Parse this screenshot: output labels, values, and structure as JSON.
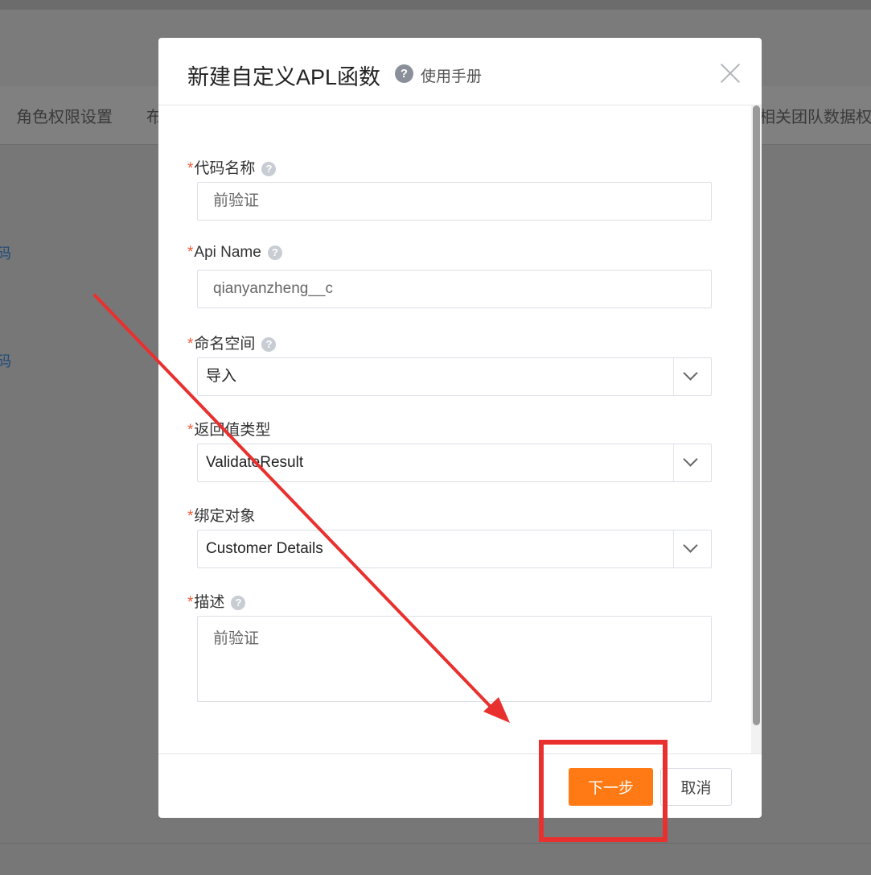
{
  "background": {
    "tabs": [
      "角色权限设置",
      "布",
      "相关团队数据权"
    ],
    "links": [
      "码",
      "码"
    ]
  },
  "modal": {
    "title": "新建自定义APL函数",
    "help_icon": "question-icon",
    "help_text": "使用手册",
    "close_icon": "close-icon",
    "fields": {
      "code_name": {
        "required_mark": "*",
        "label": "代码名称",
        "value": "前验证"
      },
      "api_name": {
        "required_mark": "*",
        "label": "Api Name",
        "value": "qianyanzheng__c"
      },
      "namespace": {
        "required_mark": "*",
        "label": "命名空间",
        "value": "导入"
      },
      "return_type": {
        "required_mark": "*",
        "label": "返回值类型",
        "value": "ValidateResult"
      },
      "bind_object": {
        "required_mark": "*",
        "label": "绑定对象",
        "value": "Customer Details"
      },
      "description": {
        "required_mark": "*",
        "label": "描述",
        "value": "前验证"
      }
    },
    "footer": {
      "next_label": "下一步",
      "cancel_label": "取消"
    }
  },
  "annotation": {
    "color": "#e8312f"
  },
  "colors": {
    "accent": "#ff7a14",
    "required": "#f25b3a"
  }
}
